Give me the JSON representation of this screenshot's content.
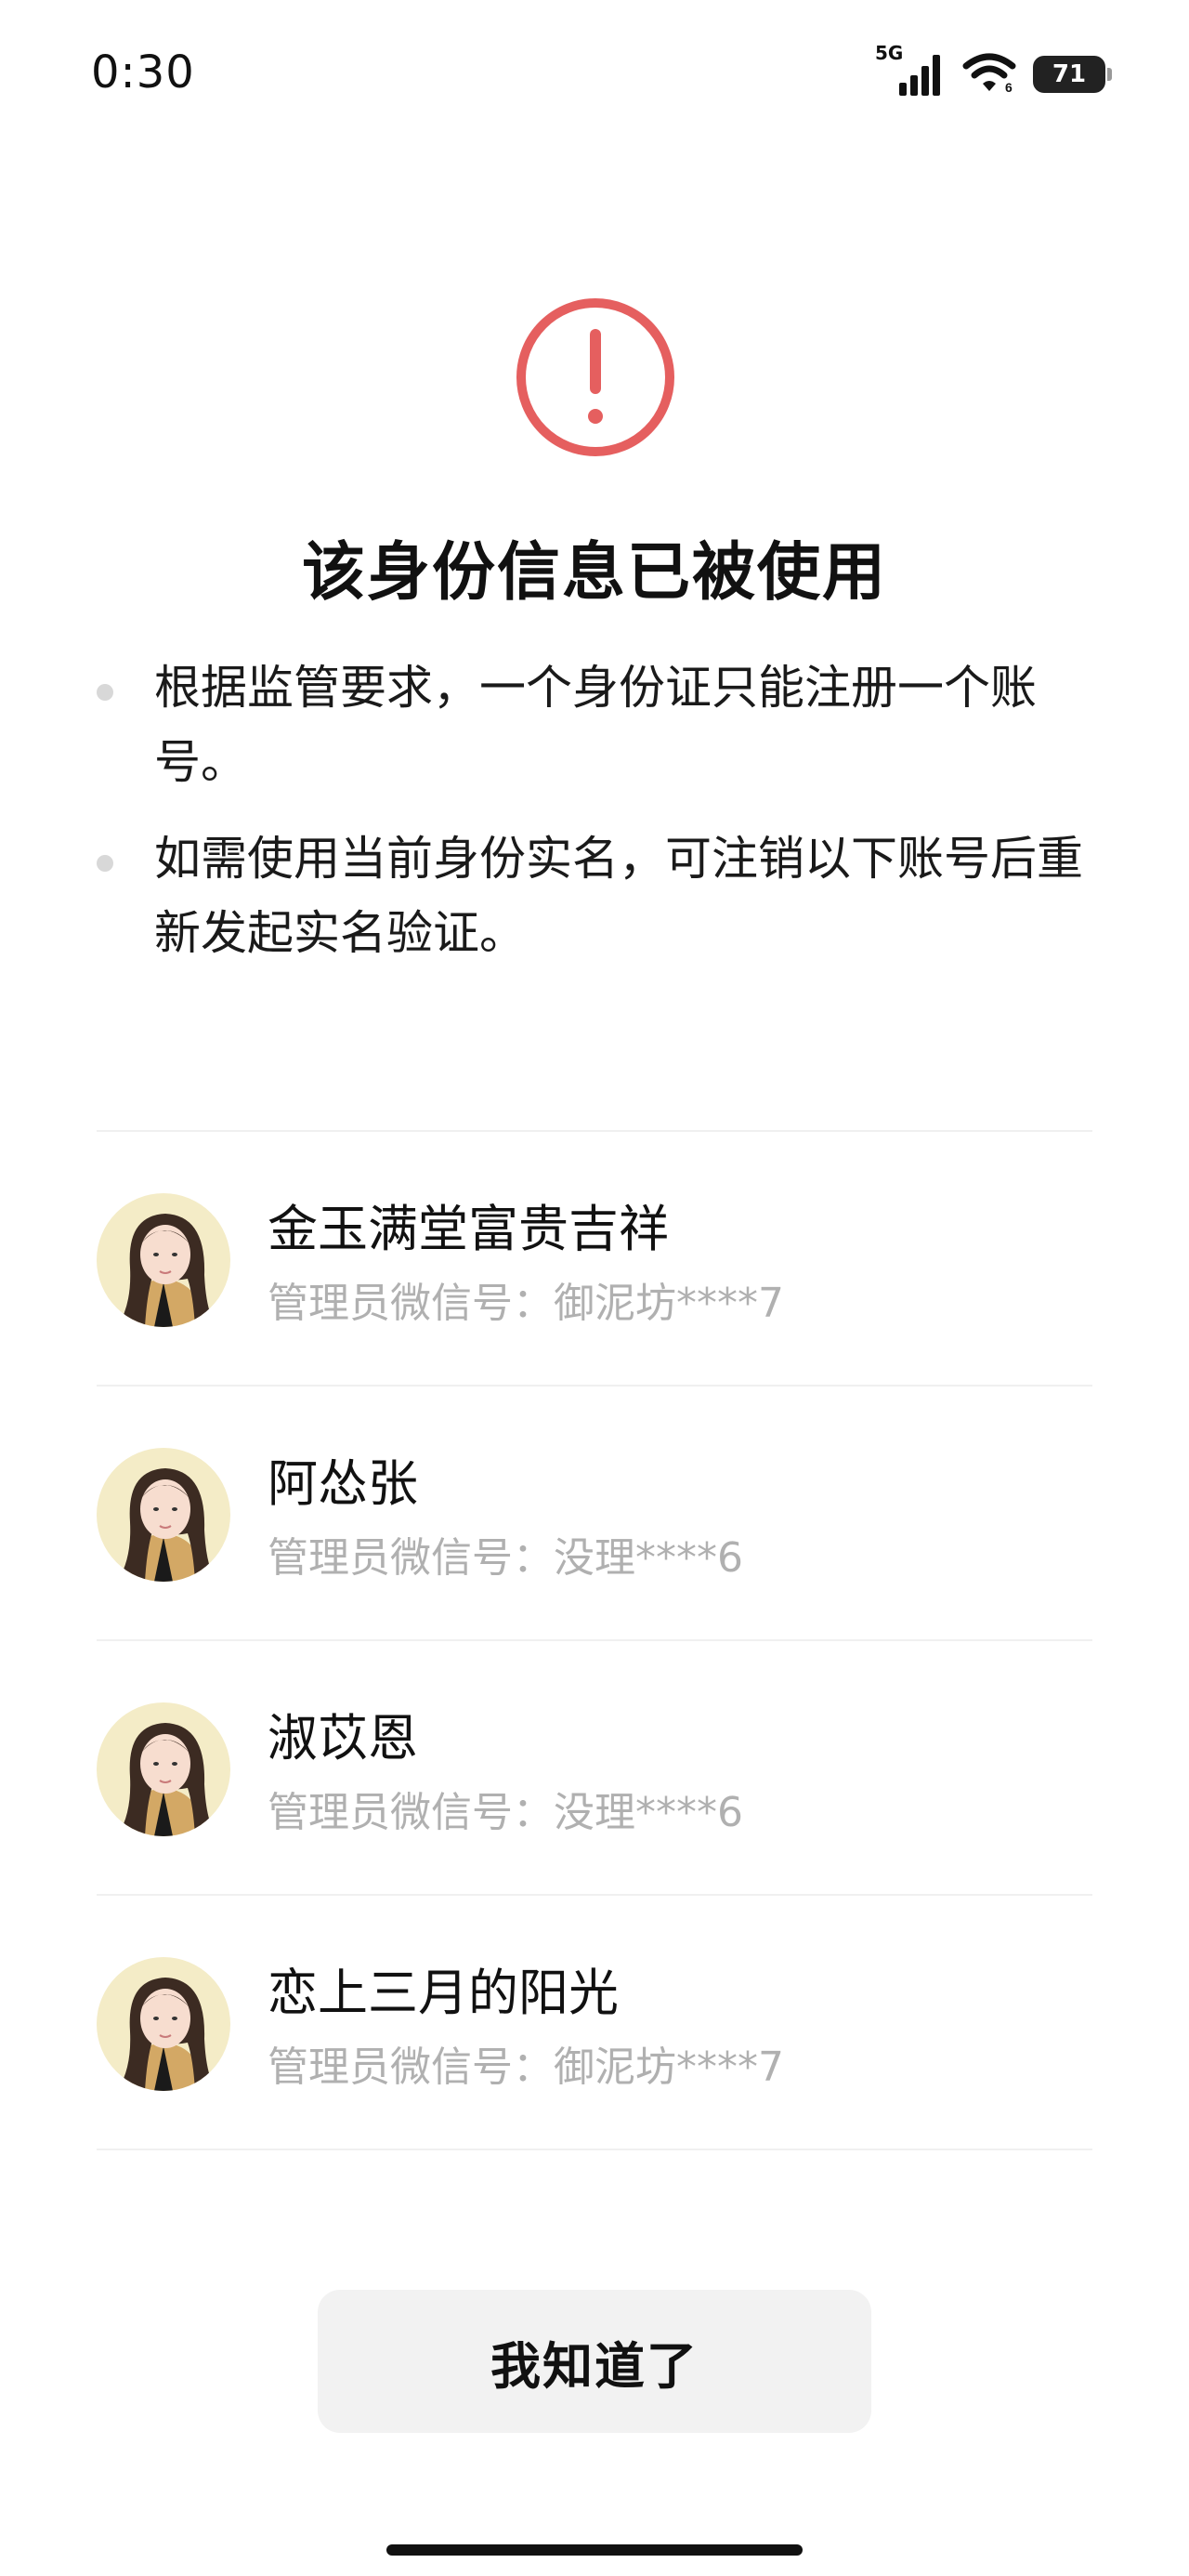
{
  "status_bar": {
    "time": "0:30",
    "network": "5G",
    "battery": "71",
    "icons": [
      "signal-icon",
      "wifi-icon",
      "battery-icon"
    ]
  },
  "alert": {
    "icon": "error-icon",
    "accent_color": "#e55f5f",
    "title": "该身份信息已被使用"
  },
  "notes": [
    "根据监管要求，一个身份证只能注册一个账号。",
    "如需使用当前身份实名，可注销以下账号后重新发起实名验证。"
  ],
  "accounts": [
    {
      "name": "金玉满堂富贵吉祥",
      "admin_wechat": "管理员微信号：御泥坊****7",
      "avatar": "avatar-image"
    },
    {
      "name": "阿怂张",
      "admin_wechat": "管理员微信号：没理****6",
      "avatar": "avatar-image"
    },
    {
      "name": "淑苡恩",
      "admin_wechat": "管理员微信号：没理****6",
      "avatar": "avatar-image"
    },
    {
      "name": "恋上三月的阳光",
      "admin_wechat": "管理员微信号：御泥坊****7",
      "avatar": "avatar-image"
    }
  ],
  "button": {
    "label": "我知道了"
  }
}
